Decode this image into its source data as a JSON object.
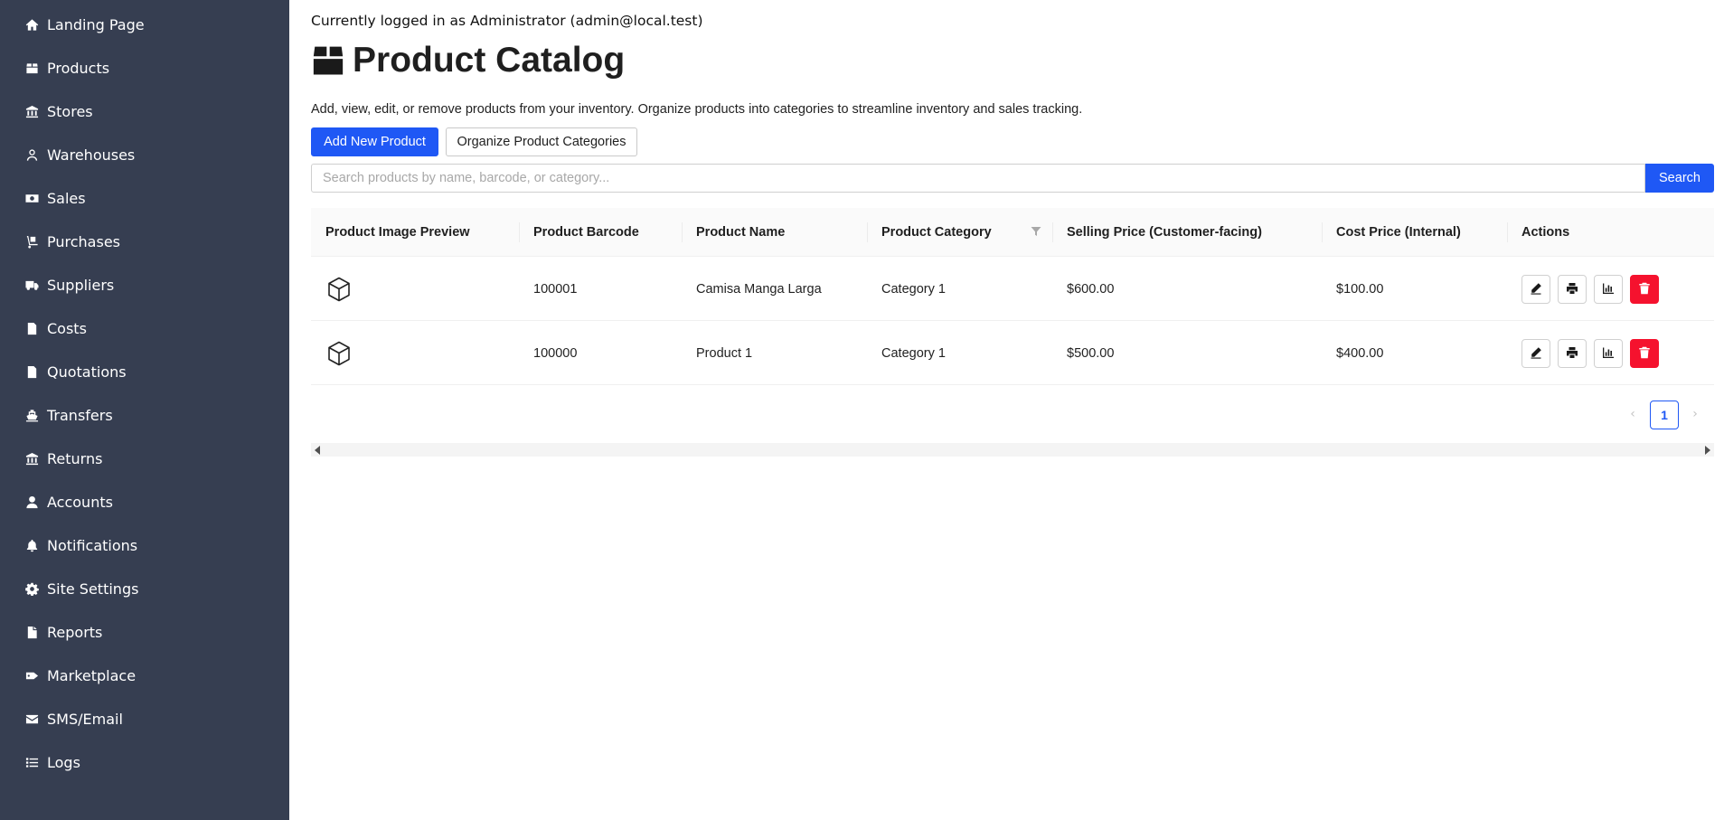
{
  "sidebar": {
    "items": [
      {
        "label": "Landing Page",
        "icon": "home-icon"
      },
      {
        "label": "Products",
        "icon": "box-icon"
      },
      {
        "label": "Stores",
        "icon": "store-icon"
      },
      {
        "label": "Warehouses",
        "icon": "user-outline-icon"
      },
      {
        "label": "Sales",
        "icon": "money-icon"
      },
      {
        "label": "Purchases",
        "icon": "dolly-icon"
      },
      {
        "label": "Suppliers",
        "icon": "truck-icon"
      },
      {
        "label": "Costs",
        "icon": "receipt-icon"
      },
      {
        "label": "Quotations",
        "icon": "invoice-icon"
      },
      {
        "label": "Transfers",
        "icon": "ship-icon"
      },
      {
        "label": "Returns",
        "icon": "bank-icon"
      },
      {
        "label": "Accounts",
        "icon": "user-icon"
      },
      {
        "label": "Notifications",
        "icon": "bell-icon"
      },
      {
        "label": "Site Settings",
        "icon": "gear-icon"
      },
      {
        "label": "Reports",
        "icon": "file-icon"
      },
      {
        "label": "Marketplace",
        "icon": "tag-icon"
      },
      {
        "label": "SMS/Email",
        "icon": "envelope-icon"
      },
      {
        "label": "Logs",
        "icon": "list-icon"
      }
    ]
  },
  "header": {
    "login_info": "Currently logged in as Administrator (admin@local.test)",
    "title": "Product Catalog",
    "title_icon": "box-icon",
    "description": "Add, view, edit, or remove products from your inventory. Organize products into categories to streamline inventory and sales tracking."
  },
  "toolbar": {
    "add_label": "Add New Product",
    "organize_label": "Organize Product Categories",
    "search_placeholder": "Search products by name, barcode, or category...",
    "search_value": "",
    "search_label": "Search"
  },
  "table": {
    "columns": [
      "Product Image Preview",
      "Product Barcode",
      "Product Name",
      "Product Category",
      "Selling Price (Customer-facing)",
      "Cost Price (Internal)",
      "Actions"
    ],
    "rows": [
      {
        "image": "cube-icon",
        "barcode": "100001",
        "name": "Camisa Manga Larga",
        "category": "Category 1",
        "selling_price": "$600.00",
        "cost_price": "$100.00"
      },
      {
        "image": "cube-icon",
        "barcode": "100000",
        "name": "Product 1",
        "category": "Category 1",
        "selling_price": "$500.00",
        "cost_price": "$400.00"
      }
    ],
    "actions": [
      "pencil-icon",
      "print-icon",
      "chart-icon",
      "trash-icon"
    ]
  },
  "pagination": {
    "current_page": "1",
    "prev_icon": "chevron-left-icon",
    "next_icon": "chevron-right-icon"
  },
  "colors": {
    "sidebar_bg": "#363e51",
    "primary": "#1f58f5",
    "danger": "#f5122e"
  }
}
